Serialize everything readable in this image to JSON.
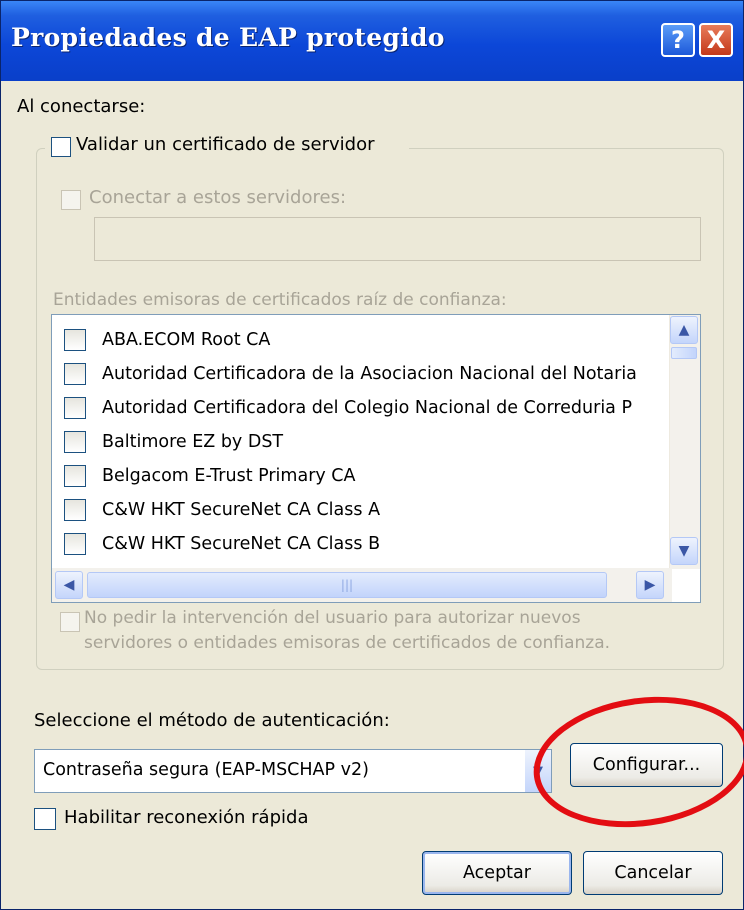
{
  "window": {
    "title": "Propiedades de EAP protegido",
    "help_label": "?",
    "close_label": "X"
  },
  "connect_label": "Al conectarse:",
  "validate_cert_label": "Validar un certificado de servidor",
  "connect_servers_label": "Conectar a estos servidores:",
  "servers_value": "",
  "trusted_ca_label": "Entidades emisoras de certificados raíz de confianza:",
  "ca_list": [
    "ABA.ECOM Root CA",
    "Autoridad Certificadora de la Asociacion Nacional del Notaria",
    "Autoridad Certificadora del Colegio Nacional de Correduria P",
    "Baltimore EZ by DST",
    "Belgacom E-Trust Primary CA",
    "C&W HKT SecureNet CA Class A",
    "C&W HKT SecureNet CA Class B"
  ],
  "no_prompt_label": "No pedir la intervención del usuario para autorizar nuevos",
  "no_prompt_label_2": "servidores o entidades emisoras de certificados de confianza.",
  "auth_method_label": "Seleccione el método de autenticación:",
  "auth_method_value": "Contraseña segura (EAP-MSCHAP v2)",
  "configure_label": "Configurar...",
  "fast_reconnect_label": "Habilitar reconexión rápida",
  "ok_label": "Aceptar",
  "cancel_label": "Cancelar",
  "colors": {
    "title_bar": "#0c47d8",
    "dialog_bg": "#ece9d8",
    "highlight_circle": "#e30d12"
  },
  "icons": {
    "scroll_up": "▲",
    "scroll_down": "▼",
    "scroll_left": "◀",
    "scroll_right": "▶",
    "dropdown": "▼"
  }
}
